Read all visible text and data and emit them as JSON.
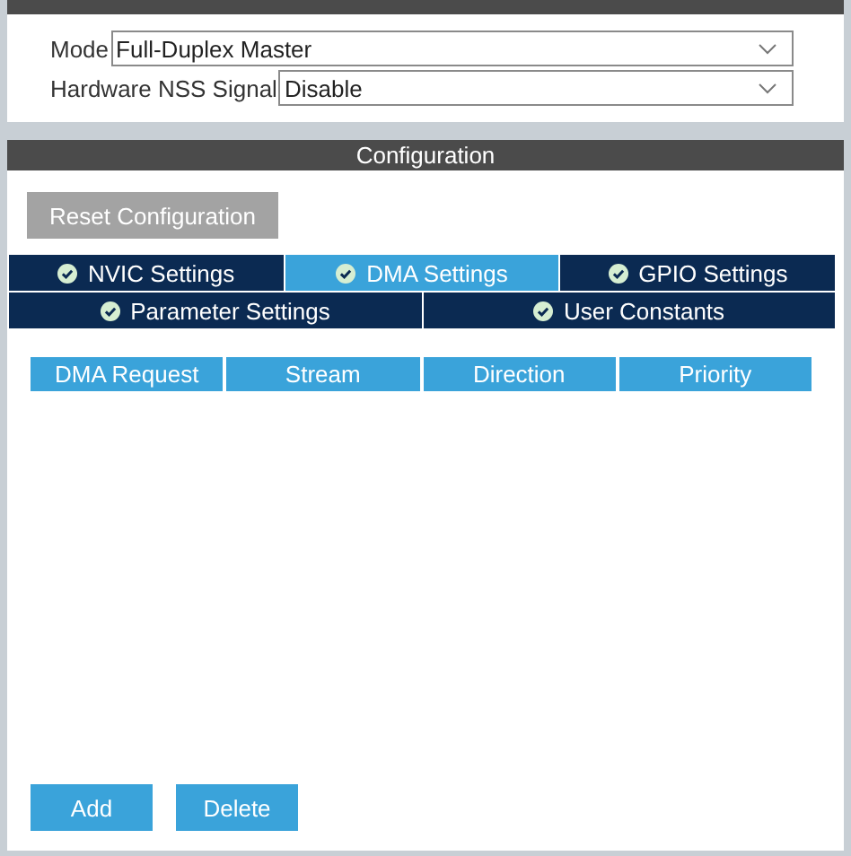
{
  "mode_section": {
    "fields": [
      {
        "label": "Mode",
        "value": "Full-Duplex Master"
      },
      {
        "label": "Hardware NSS Signal",
        "value": "Disable"
      }
    ]
  },
  "configuration": {
    "title": "Configuration",
    "reset_button": "Reset Configuration",
    "tab_rows": [
      [
        {
          "label": "NVIC Settings",
          "selected": false
        },
        {
          "label": "DMA Settings",
          "selected": true
        },
        {
          "label": "GPIO Settings",
          "selected": false
        }
      ],
      [
        {
          "label": "Parameter Settings",
          "selected": false
        },
        {
          "label": "User Constants",
          "selected": false
        }
      ]
    ],
    "table": {
      "columns": [
        "DMA Request",
        "Stream",
        "Direction",
        "Priority"
      ]
    },
    "buttons": [
      "Add",
      "Delete"
    ]
  }
}
